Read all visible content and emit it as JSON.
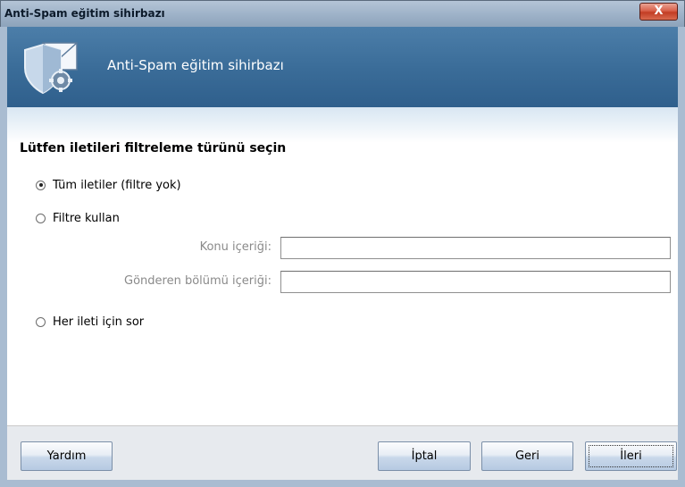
{
  "window": {
    "title": "Anti-Spam eğitim sihirbazı",
    "close_label": "X"
  },
  "header": {
    "title": "Anti-Spam eğitim sihirbazı",
    "icon": "shield-mail-gear-icon"
  },
  "main": {
    "heading": "Lütfen iletileri filtreleme türünü seçin",
    "options": [
      {
        "label": "Tüm iletiler (filtre yok)",
        "checked": true
      },
      {
        "label": "Filtre kullan",
        "checked": false
      },
      {
        "label": "Her ileti için sor",
        "checked": false
      }
    ],
    "fields": {
      "subject_label": "Konu içeriği:",
      "subject_value": "",
      "sender_label": "Gönderen bölümü içeriği:",
      "sender_value": ""
    }
  },
  "footer": {
    "help_label": "Yardım",
    "cancel_label": "İptal",
    "back_label": "Geri",
    "next_label": "İleri"
  },
  "colors": {
    "header_bg": "#3b6d99",
    "titlebar_bg": "#9fb3c9",
    "close_bg": "#c23d24",
    "footer_bg": "#e7eaee"
  }
}
